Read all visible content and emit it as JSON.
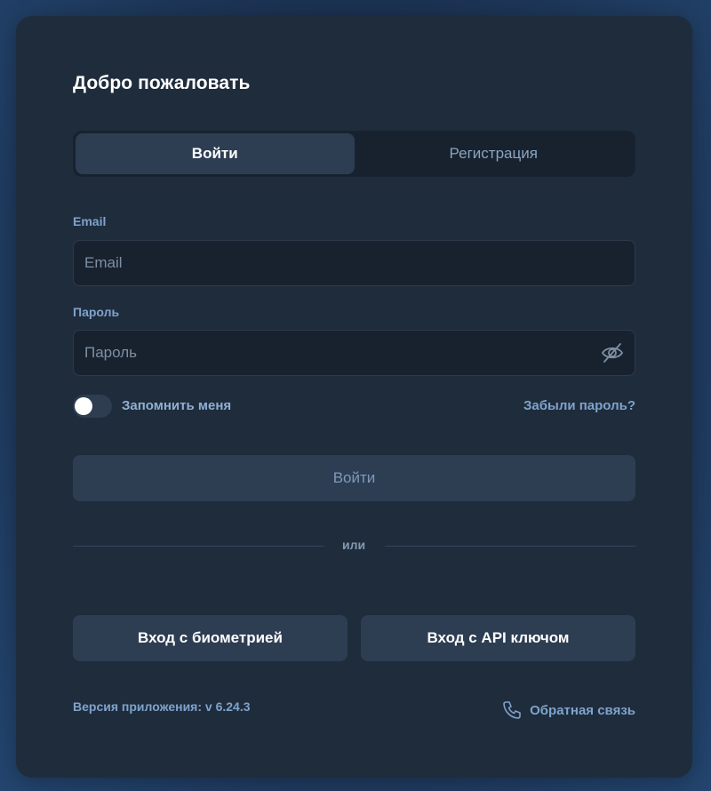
{
  "title": "Добро пожаловать",
  "tabs": [
    {
      "label": "Войти",
      "active": true
    },
    {
      "label": "Регистрация",
      "active": false
    }
  ],
  "email": {
    "label": "Email",
    "placeholder": "Email",
    "value": ""
  },
  "password": {
    "label": "Пароль",
    "placeholder": "Пароль",
    "value": "",
    "toggle_icon": "eye-off-icon"
  },
  "remember": {
    "label": "Запомнить меня",
    "checked": false
  },
  "forgot_label": "Забыли пароль?",
  "submit_label": "Войти",
  "divider_label": "или",
  "alt_buttons": {
    "biometric_label": "Вход с биометрией",
    "api_key_label": "Вход с API ключом"
  },
  "footer": {
    "version": "Версия приложения: v 6.24.3",
    "feedback_label": "Обратная связь",
    "feedback_icon": "phone-icon"
  },
  "colors": {
    "card_bg": "#1f2c3c",
    "input_bg": "#18222e",
    "button_bg": "#2d3d52",
    "accent_text": "#7fa3cc"
  }
}
